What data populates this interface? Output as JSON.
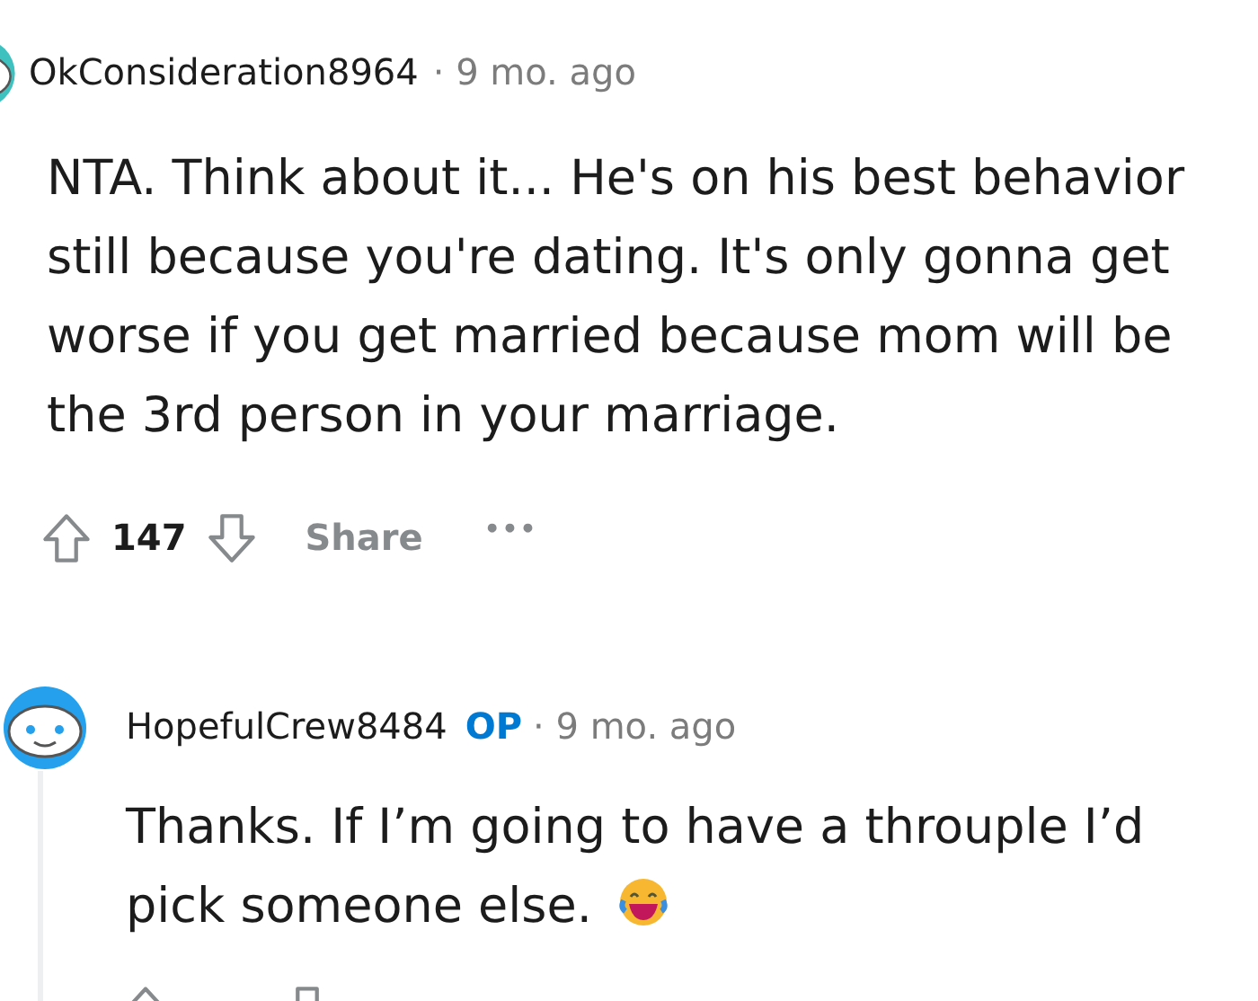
{
  "comments": [
    {
      "author": "OkConsideration8964",
      "time": "9 mo. ago",
      "color": "#3fc1c0",
      "body": "NTA. Think about it... He's on his best behavior still because you're dating. It's only gonna get worse if you get married because mom will be the 3rd person in your marriage.",
      "votes": "147",
      "share": "Share",
      "more": "•••"
    },
    {
      "author": "HopefulCrew8484",
      "op_label": "OP",
      "time": "9 mo. ago",
      "color": "#24a0ed",
      "body": "Thanks. If I’m going to have a throuple I’d pick someone else.",
      "emoji": true
    }
  ],
  "separator": "·"
}
